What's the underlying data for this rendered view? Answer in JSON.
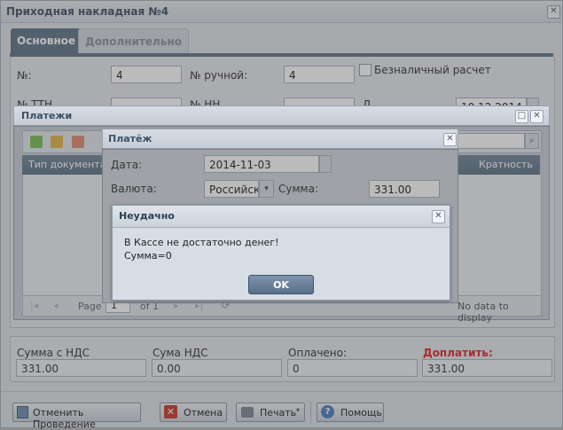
{
  "window": {
    "title": "Приходная накладная №4"
  },
  "tabs": [
    {
      "label": "Основное"
    },
    {
      "label": "Дополнительно"
    }
  ],
  "form": {
    "number_label": "№:",
    "number_value": "4",
    "manual_number_label": "№ ручной:",
    "manual_number_value": "4",
    "cashless_label": "Безналичный расчет",
    "ttn_label": "№ ТТН",
    "nn_label": "№ НН",
    "date_label": "Д",
    "date_value": "10.12.2014"
  },
  "payments": {
    "title": "Платежи",
    "col_doc_type": "Тип документа",
    "col_multiplicity": "Кратность",
    "pager_page": "Page",
    "pager_value": "1",
    "pager_of": "of 1",
    "no_data": "No data to display"
  },
  "payment": {
    "title": "Платёж",
    "date_label": "Дата:",
    "date_value": "2014-11-03",
    "currency_label": "Валюта:",
    "currency_value": "Российск",
    "sum_label": "Сумма:",
    "sum_value": "331.00"
  },
  "alert": {
    "title": "Неудачно",
    "message_line1": "В Кассе не достаточно денег!",
    "message_line2": "Сумма=0",
    "ok_label": "OK"
  },
  "totals": {
    "sum_vat_label": "Сумма с НДС",
    "sum_vat_value": "331.00",
    "vat_label": "Сума НДС",
    "vat_value": "0.00",
    "paid_label": "Оплачено:",
    "paid_value": "0",
    "topay_label": "Доплатить:",
    "topay_value": "331.00",
    "topay_color": "#e0262a"
  },
  "footer": {
    "cancel_posting_label": "Отменить Проведение",
    "cancel_label": "Отмена",
    "print_label": "Печать",
    "help_label": "Помощь"
  }
}
